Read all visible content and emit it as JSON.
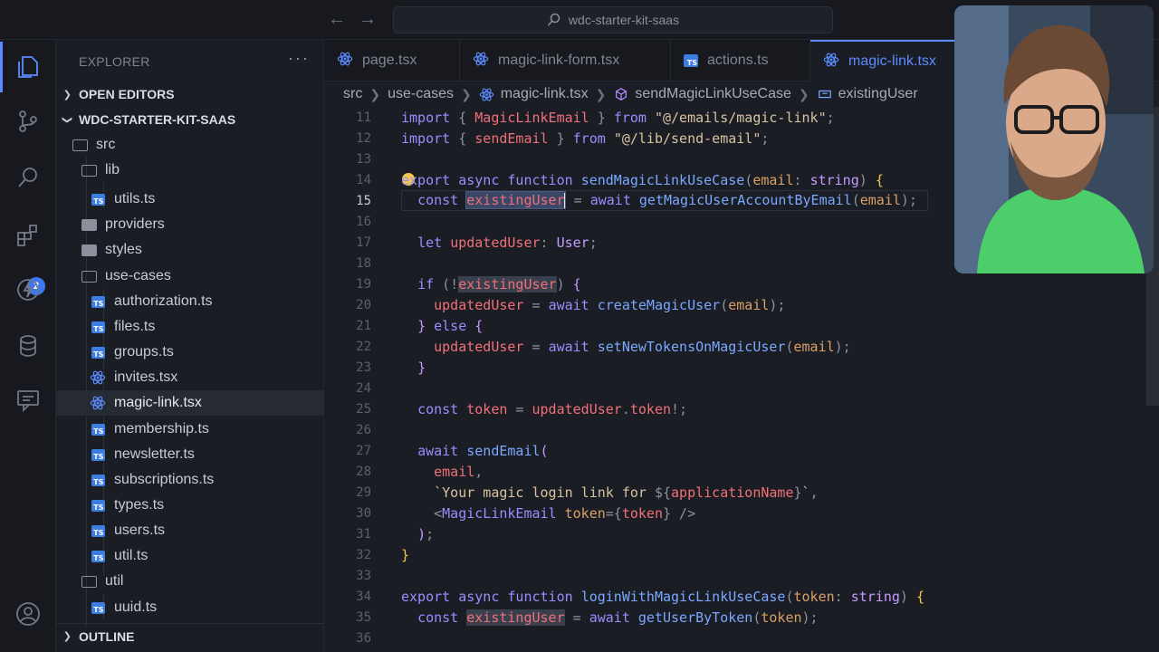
{
  "window": {
    "search_text": "wdc-starter-kit-saas"
  },
  "activity_bar": {
    "badge_count": "2"
  },
  "explorer": {
    "title": "EXPLORER",
    "more": "···",
    "open_editors": "OPEN EDITORS",
    "project": "WDC-STARTER-KIT-SAAS",
    "outline": "OUTLINE",
    "tree": [
      {
        "label": "src",
        "kind": "folder"
      },
      {
        "label": "lib",
        "kind": "folder"
      },
      {
        "label": "utils.ts",
        "kind": "ts"
      },
      {
        "label": "providers",
        "kind": "folder"
      },
      {
        "label": "styles",
        "kind": "folder"
      },
      {
        "label": "use-cases",
        "kind": "folder"
      },
      {
        "label": "authorization.ts",
        "kind": "ts"
      },
      {
        "label": "files.ts",
        "kind": "ts"
      },
      {
        "label": "groups.ts",
        "kind": "ts"
      },
      {
        "label": "invites.tsx",
        "kind": "react"
      },
      {
        "label": "magic-link.tsx",
        "kind": "react"
      },
      {
        "label": "membership.ts",
        "kind": "ts"
      },
      {
        "label": "newsletter.ts",
        "kind": "ts"
      },
      {
        "label": "subscriptions.ts",
        "kind": "ts"
      },
      {
        "label": "types.ts",
        "kind": "ts"
      },
      {
        "label": "users.ts",
        "kind": "ts"
      },
      {
        "label": "util.ts",
        "kind": "ts"
      },
      {
        "label": "util",
        "kind": "folder"
      },
      {
        "label": "uuid.ts",
        "kind": "ts"
      }
    ]
  },
  "tabs": [
    {
      "label": "page.tsx",
      "kind": "react"
    },
    {
      "label": "magic-link-form.tsx",
      "kind": "react"
    },
    {
      "label": "actions.ts",
      "kind": "ts"
    },
    {
      "label": "magic-link.tsx",
      "kind": "react",
      "active": true
    }
  ],
  "breadcrumb": [
    "src",
    "use-cases",
    "magic-link.tsx",
    "sendMagicLinkUseCase",
    "existingUser"
  ],
  "editor": {
    "line_numbers": [
      "11",
      "12",
      "13",
      "14",
      "15",
      "16",
      "17",
      "18",
      "19",
      "20",
      "21",
      "22",
      "23",
      "24",
      "25",
      "26",
      "27",
      "28",
      "29",
      "30",
      "31",
      "32",
      "33",
      "34",
      "35",
      "36"
    ],
    "current_line": "15"
  },
  "colors": {
    "accent": "#5b8cff",
    "keyword": "#9b8cff",
    "function": "#7aa8ff",
    "variable": "#f07078",
    "string": "#d8c3a0"
  },
  "icons": [
    "explorer-icon",
    "source-control-icon",
    "search-icon",
    "extensions-icon",
    "bolt-icon",
    "database-icon",
    "comment-icon",
    "account-icon"
  ]
}
